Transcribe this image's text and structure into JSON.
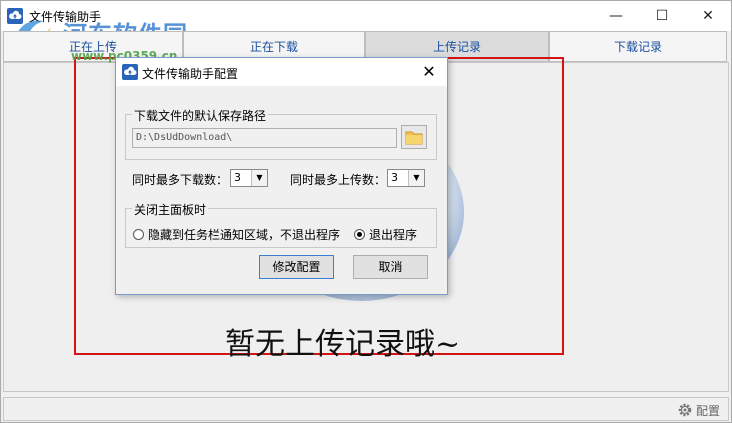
{
  "window": {
    "title": "文件传输助手",
    "watermark": "河东软件园",
    "watermark_url": "www.pc0359.cn",
    "minimize": "—",
    "maximize": "☐",
    "close": "✕"
  },
  "tabs": [
    {
      "label": "正在上传"
    },
    {
      "label": "正在下载"
    },
    {
      "label": "上传记录",
      "active": true
    },
    {
      "label": "下载记录"
    }
  ],
  "main": {
    "empty_message": "暂无上传记录哦~"
  },
  "statusbar": {
    "config_label": "配置"
  },
  "dialog": {
    "title": "文件传输助手配置",
    "close": "✕",
    "path_group_label": "下载文件的默认保存路径",
    "path_value": "D:\\DsUdDownload\\",
    "max_download_label": "同时最多下载数：",
    "max_download_value": "3",
    "max_upload_label": "同时最多上传数：",
    "max_upload_value": "3",
    "close_group_label": "关闭主面板时",
    "option_hide": "隐藏到任务栏通知区域，不退出程序",
    "option_exit": "退出程序",
    "selected_option": "exit",
    "modify_button": "修改配置",
    "cancel_button": "取消"
  },
  "colors": {
    "tab_text": "#1a4fa0",
    "highlight_box": "#d41414"
  }
}
